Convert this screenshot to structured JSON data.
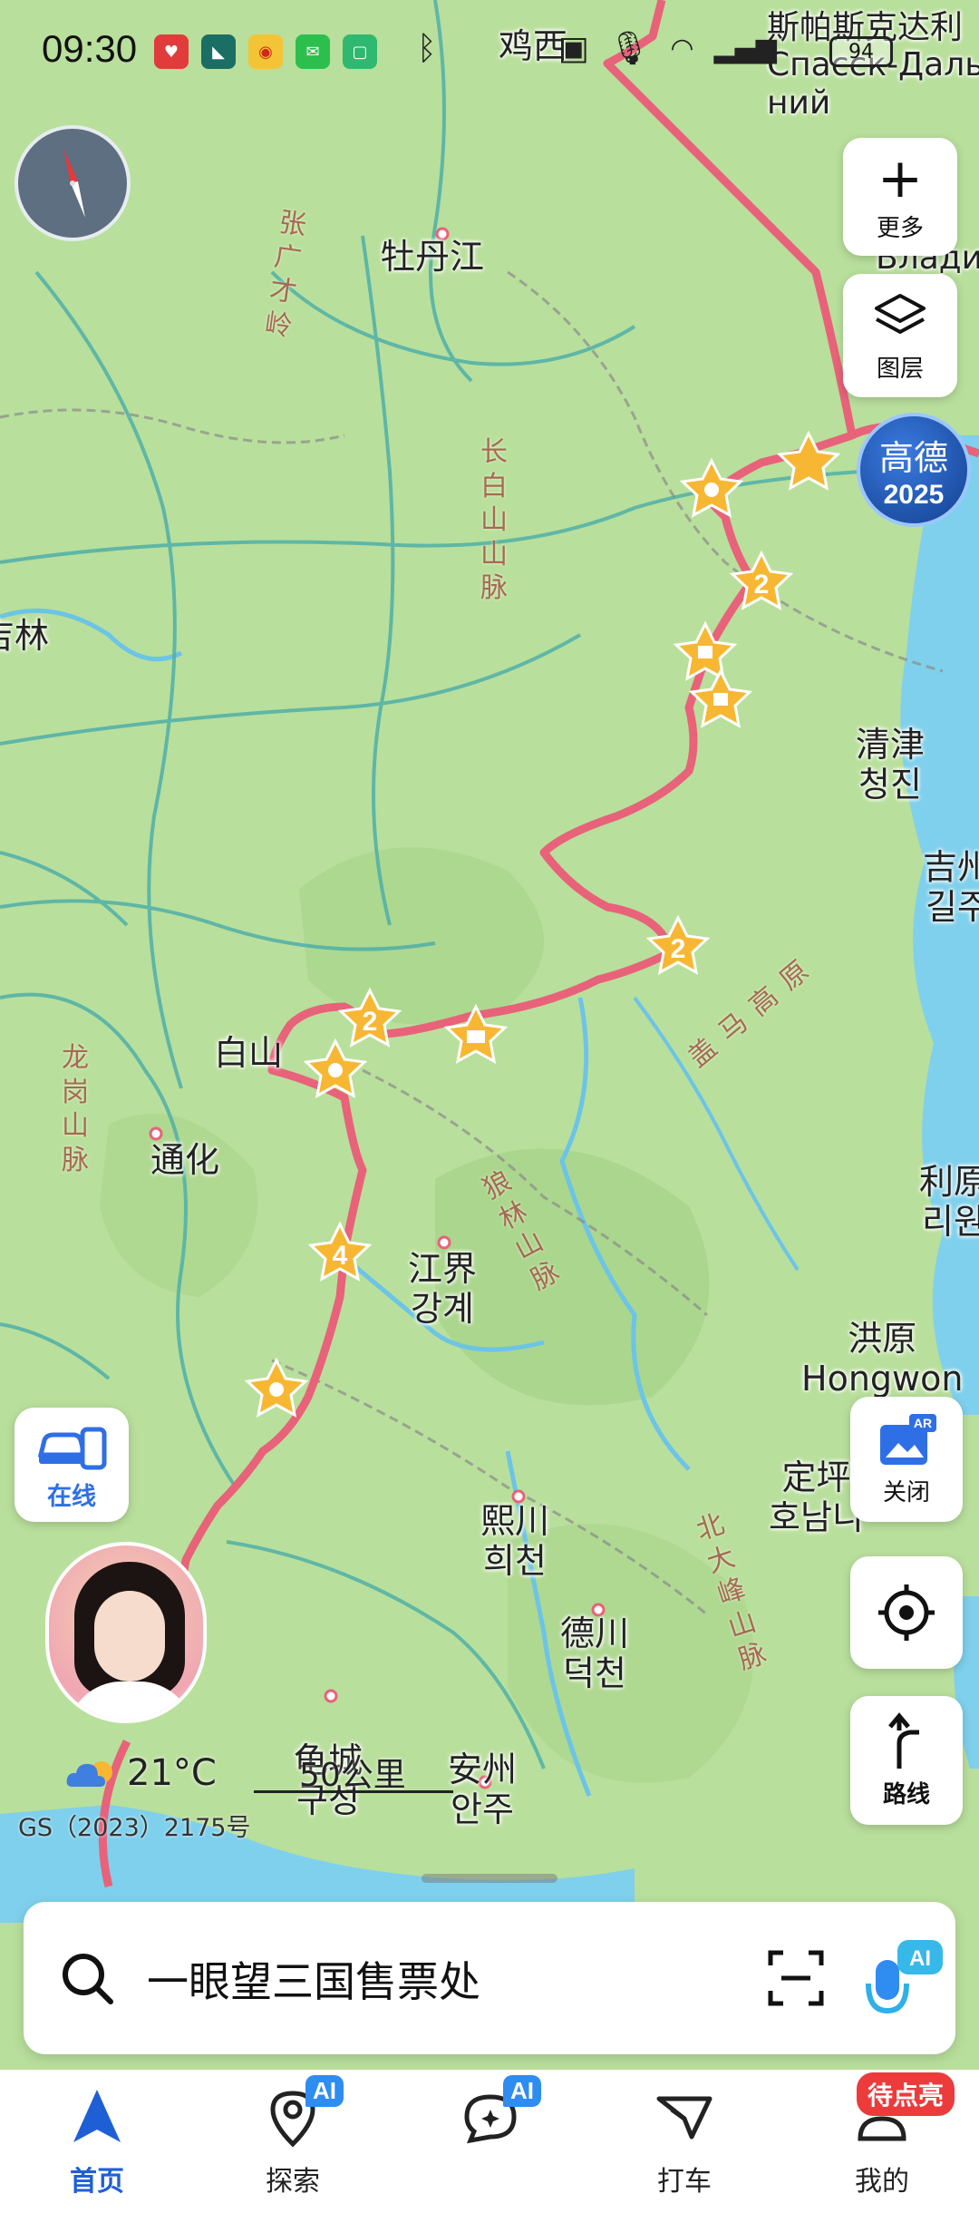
{
  "status_bar": {
    "time": "09:30",
    "battery": "94",
    "app_icons": [
      "huawei-health-icon",
      "app-icon",
      "weibo-icon",
      "wechat-icon",
      "app-icon"
    ],
    "system_icons": [
      "bluetooth-icon",
      "mic-icon",
      "vibrate-icon",
      "wifi-icon",
      "signal-icon"
    ]
  },
  "map": {
    "cities": [
      {
        "name": "鸡西"
      },
      {
        "name": "牡丹江"
      },
      {
        "name": "吉林"
      },
      {
        "name": "白山"
      },
      {
        "name": "通化"
      },
      {
        "name": "江界",
        "sub": "강계"
      },
      {
        "name": "熙川",
        "sub": "희천"
      },
      {
        "name": "德川",
        "sub": "덕천"
      },
      {
        "name": "安州",
        "sub": "안주"
      },
      {
        "name": "龟城",
        "sub": "구성"
      },
      {
        "name": "清津",
        "sub": "청진"
      },
      {
        "name": "吉州",
        "sub": "길주"
      },
      {
        "name": "利原",
        "sub": "리원"
      },
      {
        "name": "洪原",
        "sub": "Hongwon"
      },
      {
        "name": "定坪",
        "sub": "호남니"
      },
      {
        "name": "斯帕斯克达利",
        "sub": "Спасск-Даль",
        "sub2": "ний"
      },
      {
        "name": "Владив"
      }
    ],
    "mountains": [
      "张广才岭",
      "长白山山脉",
      "龙岗山脉",
      "狼林山脉",
      "盖马高原",
      "北大峰山脉"
    ],
    "markers": [
      "2",
      "2",
      "2",
      "4"
    ]
  },
  "controls": {
    "more_label": "更多",
    "layers_label": "图层",
    "promo_text": "高德",
    "promo_year": "2025",
    "ar_label": "关闭",
    "route_label": "路线",
    "online_label": "在线"
  },
  "weather": {
    "temp": "21°C"
  },
  "scale_label": "50公里",
  "gs_text": "GS（2023）2175号",
  "search": {
    "placeholder": "一眼望三国售票处"
  },
  "tabs": [
    {
      "label": "首页",
      "active": true
    },
    {
      "label": "探索",
      "badge": "AI"
    },
    {
      "label": "",
      "badge": "AI"
    },
    {
      "label": "打车"
    },
    {
      "label": "我的"
    }
  ],
  "mine_badge": "待点亮"
}
